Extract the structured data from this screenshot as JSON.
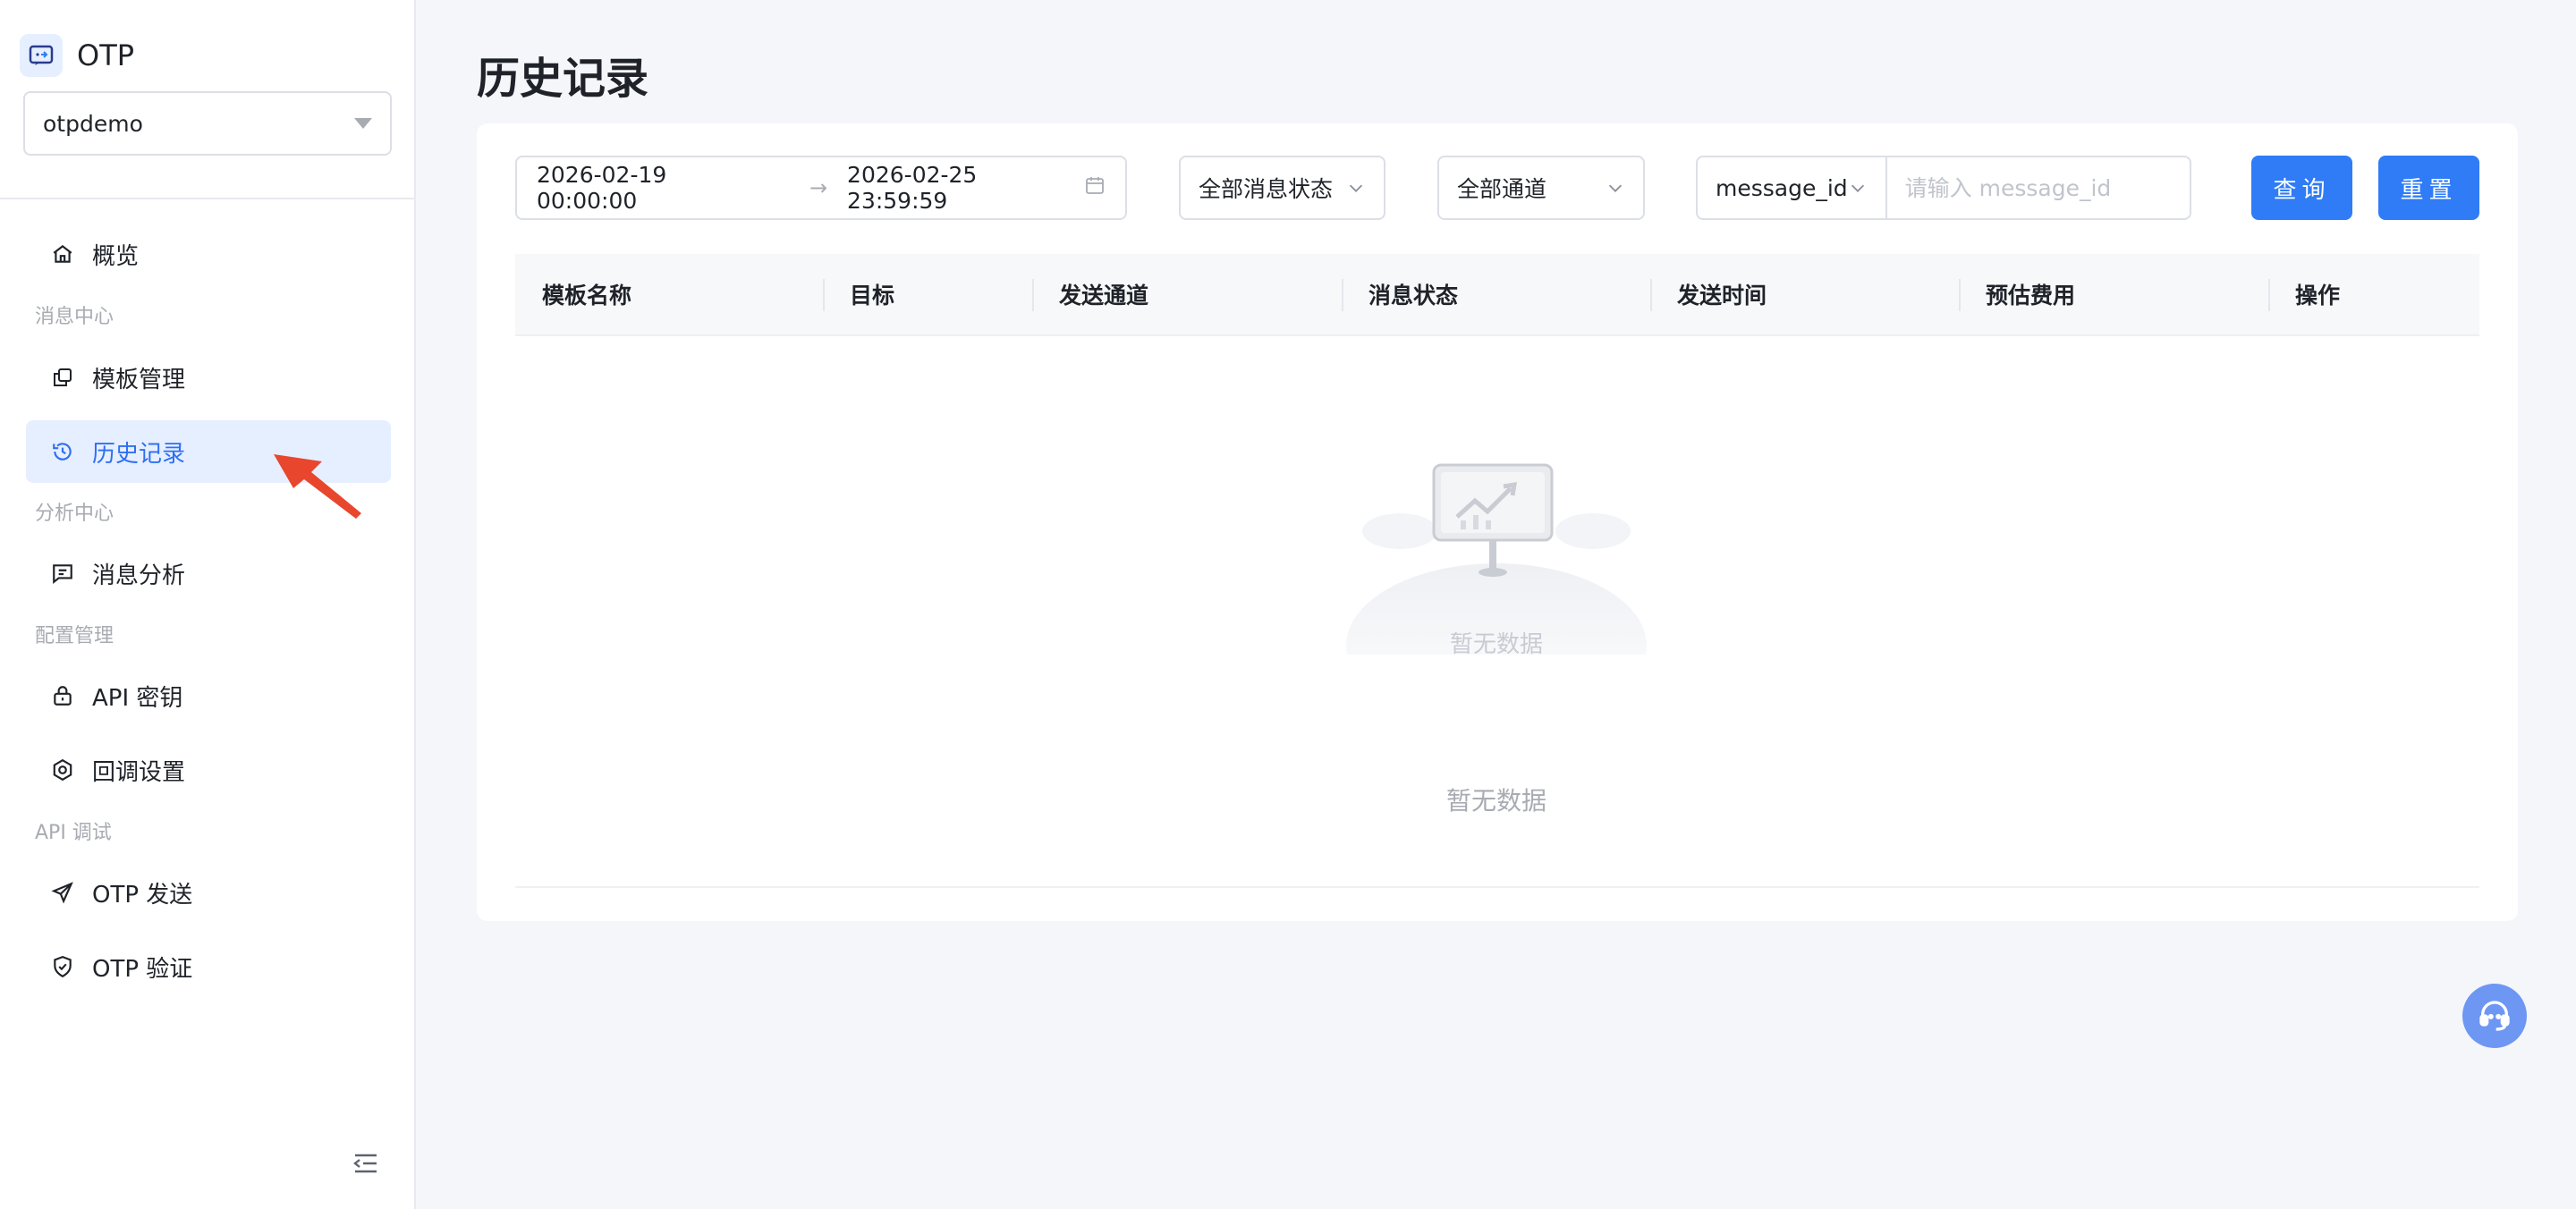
{
  "brand": {
    "name": "OTP"
  },
  "project": {
    "selected": "otpdemo"
  },
  "nav": {
    "overview": "概览",
    "groups": {
      "message_center": "消息中心",
      "analysis_center": "分析中心",
      "config": "配置管理",
      "api_debug": "API 调试"
    },
    "template_mgmt": "模板管理",
    "history": "历史记录",
    "message_analysis": "消息分析",
    "api_key": "API 密钥",
    "callback": "回调设置",
    "otp_send": "OTP 发送",
    "otp_verify": "OTP 验证"
  },
  "page": {
    "title": "历史记录"
  },
  "filters": {
    "date_start": "2026-02-19 00:00:00",
    "date_end": "2026-02-25 23:59:59",
    "date_sep": "→",
    "status": "全部消息状态",
    "channel": "全部通道",
    "id_type": "message_id",
    "id_placeholder": "请输入 message_id",
    "query_btn": "查询",
    "reset_btn": "重置"
  },
  "table": {
    "columns": [
      "模板名称",
      "目标",
      "发送通道",
      "消息状态",
      "发送时间",
      "预估费用",
      "操作"
    ],
    "rows": [],
    "empty_caption": "暂无数据",
    "empty_text": "暂无数据"
  },
  "colors": {
    "accent": "#2f7cf6",
    "active_bg": "#e6efff",
    "active_text": "#2f6ff2",
    "annotation_arrow": "#e8472e"
  },
  "icons": {
    "overview": "home-icon",
    "template": "copy-icon",
    "history": "history-icon",
    "analysis": "message-square-icon",
    "api_key": "lock-icon",
    "callback": "settings-icon",
    "send": "send-icon",
    "verify": "shield-check-icon",
    "support": "headset-icon"
  }
}
